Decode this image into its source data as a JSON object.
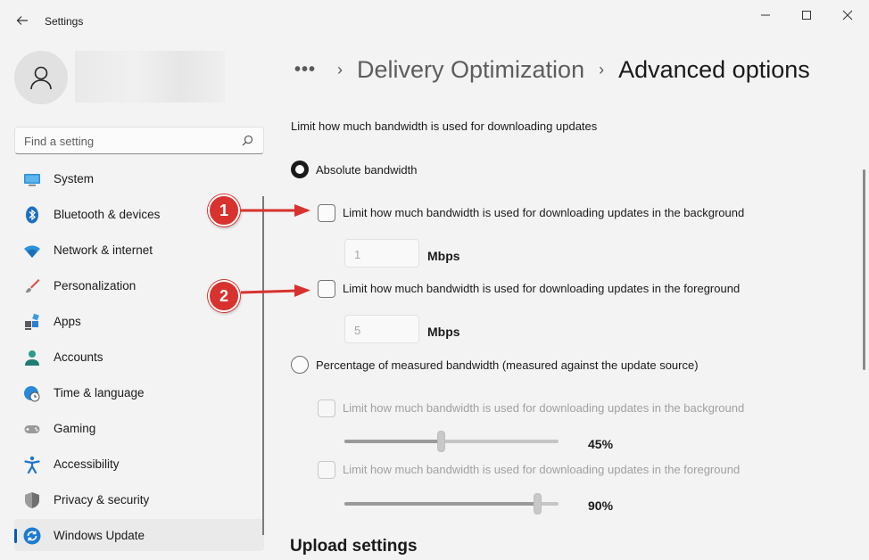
{
  "window": {
    "title": "Settings",
    "back_icon": "back-arrow-icon",
    "controls": [
      "minimize-icon",
      "maximize-icon",
      "close-icon"
    ]
  },
  "sidebar": {
    "search_placeholder": "Find a setting",
    "items": [
      {
        "label": "System",
        "icon": "system-display-icon",
        "active": false
      },
      {
        "label": "Bluetooth & devices",
        "icon": "bluetooth-icon",
        "active": false
      },
      {
        "label": "Network & internet",
        "icon": "wifi-icon",
        "active": false
      },
      {
        "label": "Personalization",
        "icon": "paintbrush-icon",
        "active": false
      },
      {
        "label": "Apps",
        "icon": "apps-icon",
        "active": false
      },
      {
        "label": "Accounts",
        "icon": "accounts-icon",
        "active": false
      },
      {
        "label": "Time & language",
        "icon": "clock-globe-icon",
        "active": false
      },
      {
        "label": "Gaming",
        "icon": "gamepad-icon",
        "active": false
      },
      {
        "label": "Accessibility",
        "icon": "accessibility-icon",
        "active": false
      },
      {
        "label": "Privacy & security",
        "icon": "shield-icon",
        "active": false
      },
      {
        "label": "Windows Update",
        "icon": "windows-update-icon",
        "active": true
      }
    ]
  },
  "breadcrumb": {
    "more": "•••",
    "separator": "›",
    "parent": "Delivery Optimization",
    "current": "Advanced options"
  },
  "main": {
    "description": "Limit how much bandwidth is used for downloading updates",
    "absolute": {
      "label": "Absolute bandwidth",
      "selected": true,
      "background": {
        "label": "Limit how much bandwidth is used for downloading updates in the background",
        "checked": false,
        "value": "1",
        "unit": "Mbps"
      },
      "foreground": {
        "label": "Limit how much bandwidth is used for downloading updates in the foreground",
        "checked": false,
        "value": "5",
        "unit": "Mbps"
      }
    },
    "percentage": {
      "label": "Percentage of measured bandwidth (measured against the update source)",
      "selected": false,
      "background": {
        "label": "Limit how much bandwidth is used for downloading updates in the background",
        "checked": false,
        "disabled": true,
        "slider_percent": 45,
        "value_text": "45%"
      },
      "foreground": {
        "label": "Limit how much bandwidth is used for downloading updates in the foreground",
        "checked": false,
        "disabled": true,
        "slider_percent": 90,
        "value_text": "90%"
      }
    },
    "upload_section_title": "Upload settings"
  },
  "annotations": [
    {
      "number": "1",
      "color": "#d8322e"
    },
    {
      "number": "2",
      "color": "#d8322e"
    }
  ]
}
